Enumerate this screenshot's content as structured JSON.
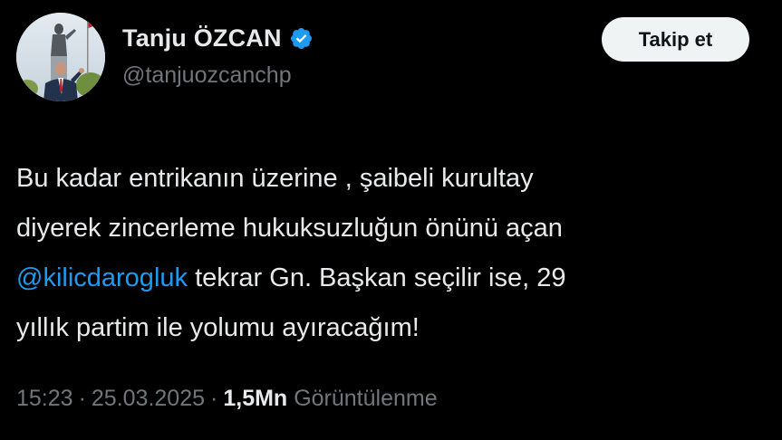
{
  "author": {
    "display_name": "Tanju ÖZCAN",
    "handle": "@tanjuozcanchp",
    "verified_icon": "verified-badge-icon",
    "accent_color": "#1d9bf0"
  },
  "follow_button": {
    "label": "Takip et"
  },
  "tweet": {
    "line1": "Bu kadar entrikanın üzerine , şaibeli kurultay",
    "line2": "diyerek zincerleme hukuksuzluğun önünü açan",
    "mention": "@kilicdarogluk",
    "line3_rest": " tekrar Gn. Başkan seçilir ise, 29",
    "line4": "yıllık partim ile yolumu ayıracağım!"
  },
  "meta": {
    "time": "15:23",
    "separator": "·",
    "date": "25.03.2025",
    "views_count": "1,5Mn",
    "views_label": "Görüntülenme"
  }
}
